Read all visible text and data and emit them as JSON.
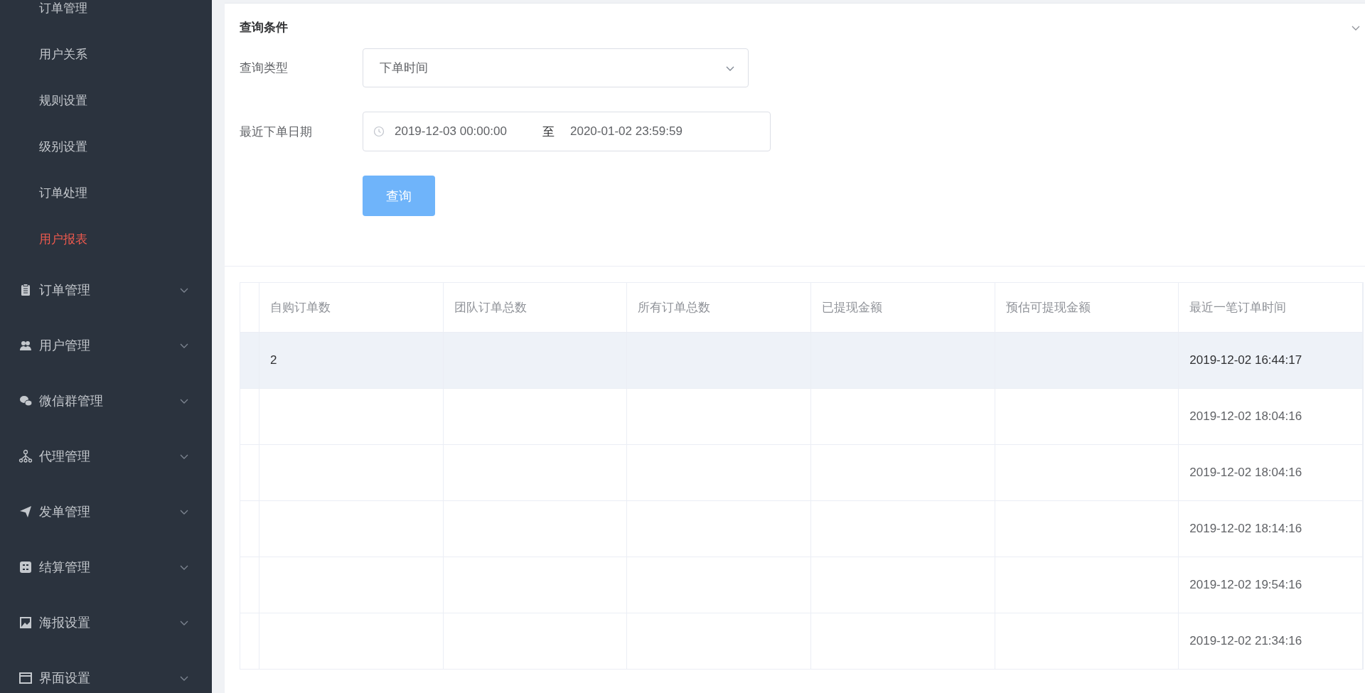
{
  "sidebar": {
    "submenu_items": [
      {
        "label": "订单管理",
        "selected": false
      },
      {
        "label": "用户关系",
        "selected": false
      },
      {
        "label": "规则设置",
        "selected": false
      },
      {
        "label": "级别设置",
        "selected": false
      },
      {
        "label": "订单处理",
        "selected": false
      },
      {
        "label": "用户报表",
        "selected": true
      }
    ],
    "menu_items": [
      {
        "label": "订单管理",
        "expanded": false
      },
      {
        "label": "用户管理",
        "expanded": false
      },
      {
        "label": "微信群管理",
        "expanded": false
      },
      {
        "label": "代理管理",
        "expanded": false
      },
      {
        "label": "发单管理",
        "expanded": false
      },
      {
        "label": "结算管理",
        "expanded": false
      },
      {
        "label": "海报设置",
        "expanded": false
      },
      {
        "label": "界面设置",
        "expanded": false
      }
    ]
  },
  "query_panel": {
    "title": "查询条件",
    "expanded": true,
    "query_type": {
      "label": "查询类型",
      "value": "下单时间"
    },
    "date_range": {
      "label": "最近下单日期",
      "start": "2019-12-03 00:00:00",
      "separator": "至",
      "end": "2020-01-02 23:59:59"
    },
    "submit_button": "查询"
  },
  "table": {
    "columns": [
      "自购订单数",
      "团队订单总数",
      "所有订单总数",
      "已提现金额",
      "预估可提现金额",
      "最近一笔订单时间"
    ],
    "rows": [
      {
        "selected": true,
        "cells": [
          "2",
          "",
          "",
          "",
          "",
          "2019-12-02 16:44:17"
        ]
      },
      {
        "selected": false,
        "cells": [
          "",
          "",
          "",
          "",
          "",
          "2019-12-02 18:04:16"
        ]
      },
      {
        "selected": false,
        "cells": [
          "",
          "",
          "",
          "",
          "",
          "2019-12-02 18:04:16"
        ]
      },
      {
        "selected": false,
        "cells": [
          "",
          "",
          "",
          "",
          "",
          "2019-12-02 18:14:16"
        ]
      },
      {
        "selected": false,
        "cells": [
          "",
          "",
          "",
          "",
          "",
          "2019-12-02 19:54:16"
        ]
      },
      {
        "selected": false,
        "cells": [
          "",
          "",
          "",
          "",
          "",
          "2019-12-02 21:34:16"
        ]
      }
    ]
  }
}
